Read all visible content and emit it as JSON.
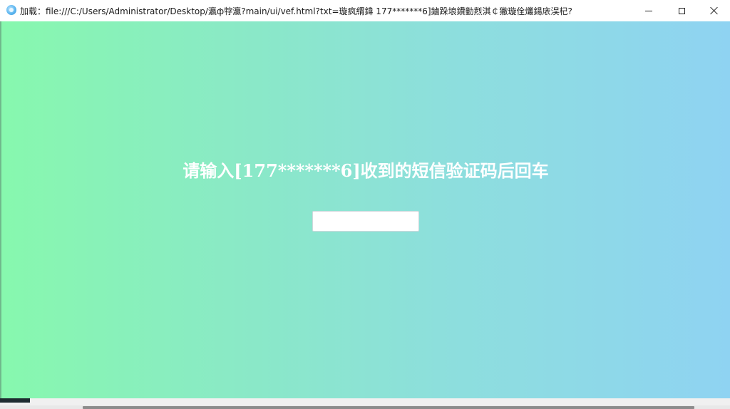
{
  "window": {
    "title": "加载：file:///C:/Users/Administrator/Desktop/瀛ф牸瀛?main/ui/vef.html?txt=璇疯緭鍏    177*******6]鏀跺埌鐨勭煭淇￠獙璇佺爜鍚庡洖杞?",
    "minimize_label": "–",
    "maximize_label": "☐",
    "close_label": "✕"
  },
  "main": {
    "prompt_text": "请输入[177*******6]收到的短信验证码后回车",
    "code_input": {
      "value": "",
      "placeholder": ""
    }
  },
  "icons": {
    "app": "app-globe-icon",
    "minimize": "minimize-icon",
    "maximize": "maximize-icon",
    "close": "close-icon"
  },
  "colors": {
    "gradient_start": "#87f8ae",
    "gradient_end": "#8fd3f2",
    "prompt_text": "#ffffff"
  }
}
